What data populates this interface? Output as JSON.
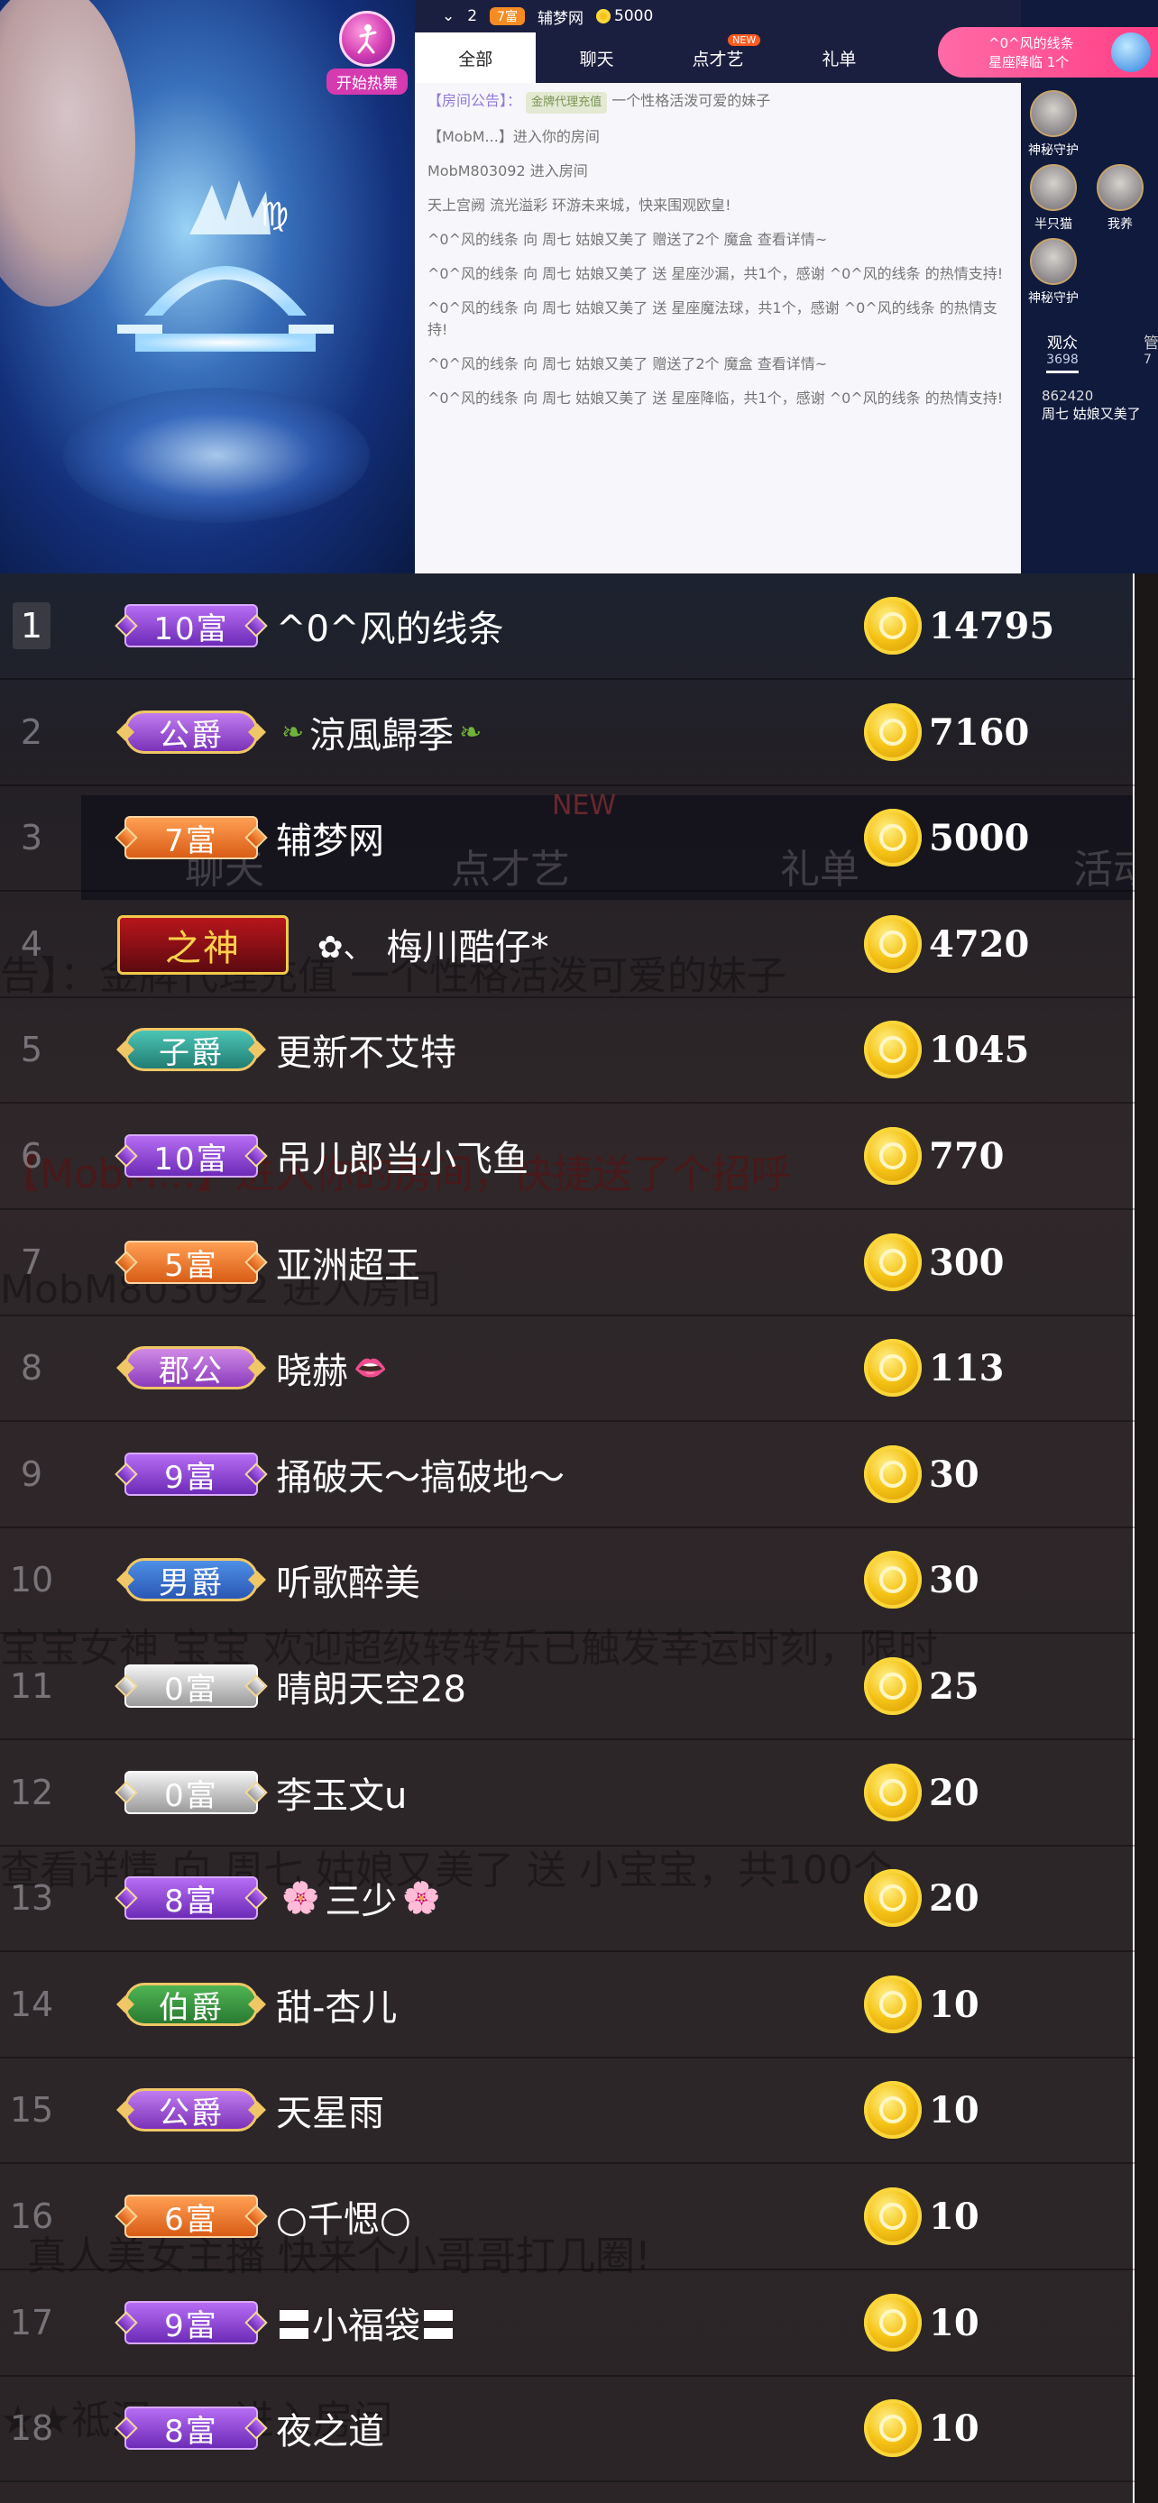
{
  "stream": {
    "start_button_label": "开始热舞",
    "star_banner": {
      "line1": "^0^风的线条",
      "line2": "星座降临 1个"
    }
  },
  "chat_panel": {
    "top_strip": {
      "rank": "2",
      "level_badge": "7富",
      "name": "辅梦网",
      "coins": "5000"
    },
    "tabs": [
      {
        "label": "全部",
        "active": true
      },
      {
        "label": "聊天",
        "active": false
      },
      {
        "label": "点才艺",
        "active": false,
        "badge": "NEW"
      },
      {
        "label": "礼单",
        "active": false
      },
      {
        "label": "活动",
        "active": false
      }
    ],
    "messages": [
      {
        "prefix": "【房间公告】：",
        "tag": "金牌代理充值",
        "text": "一个性格活泼可爱的妹子"
      },
      {
        "prefix": "",
        "tag": "",
        "text": "【MobM...】进入你的房间"
      },
      {
        "prefix": "",
        "tag": "",
        "text": "MobM803092 进入房间"
      },
      {
        "prefix": "",
        "tag": "",
        "text": "天上宫阙 流光溢彩 环游未来城，快来围观欧皇!"
      },
      {
        "prefix": "",
        "tag": "",
        "text": "^0^风的线条 向 周七 姑娘又美了 赠送了2个 魔盒 查看详情~"
      },
      {
        "prefix": "",
        "tag": "",
        "text": "^0^风的线条 向 周七 姑娘又美了 送 星座沙漏，共1个，感谢 ^0^风的线条 的热情支持!"
      },
      {
        "prefix": "",
        "tag": "",
        "text": "^0^风的线条 向 周七 姑娘又美了 送 星座魔法球，共1个，感谢 ^0^风的线条 的热情支持!"
      },
      {
        "prefix": "",
        "tag": "",
        "text": "^0^风的线条 向 周七 姑娘又美了 赠送了2个 魔盒 查看详情~"
      },
      {
        "prefix": "",
        "tag": "",
        "text": "^0^风的线条 向 周七 姑娘又美了 送 星座降临，共1个，感谢 ^0^风的线条 的热情支持!"
      }
    ]
  },
  "side_panel": {
    "guards": [
      {
        "label": "神秘守护"
      },
      {
        "label": "半只猫"
      },
      {
        "label": "我养"
      },
      {
        "label": "神秘守护"
      }
    ],
    "audience_label": "观众",
    "audience_count": "3698",
    "manager_label": "管",
    "manager_count": "7",
    "rank_score": "862420",
    "rank_name": "周七 姑娘又美了"
  },
  "ranking": {
    "background_text": [
      "聊天",
      "点才艺",
      "礼单",
      "活动",
      "NEW",
      "告】：金牌代理充值 一个性格活泼可爱的妹子",
      "【MobM...】进入你的房间，快捷送了个招呼",
      "MobM803092 进入房间",
      "宝宝女神 宝宝 欢迎超级转转乐已触发幸运时刻，限时",
      "查看详情 向 周七 姑娘又美了 送 小宝宝，共100个",
      "真人美女主播 快来个小哥哥打几圈!",
      "★★祗洞★★ 进入房间"
    ],
    "rows": [
      {
        "rank": "1",
        "badge": "10富",
        "badge_style": "b-purple",
        "name": "^0^风的线条",
        "deco_before": "",
        "deco_after": "",
        "amount": "14795"
      },
      {
        "rank": "2",
        "badge": "公爵",
        "badge_style": "b-duke",
        "name": "涼風歸季",
        "deco_before": "❧",
        "deco_after": "❧",
        "deco_style": "",
        "amount": "7160"
      },
      {
        "rank": "3",
        "badge": "7富",
        "badge_style": "b-orange",
        "name": "辅梦网",
        "deco_before": "",
        "deco_after": "",
        "amount": "5000"
      },
      {
        "rank": "4",
        "badge": "之神",
        "badge_style": "b-god",
        "name": "梅川酷仔*",
        "deco_before": "✿、",
        "deco_after": "",
        "deco_style": "star",
        "amount": "4720"
      },
      {
        "rank": "5",
        "badge": "子爵",
        "badge_style": "b-zi",
        "name": "更新不艾特",
        "deco_before": "",
        "deco_after": "",
        "amount": "1045"
      },
      {
        "rank": "6",
        "badge": "10富",
        "badge_style": "b-purple",
        "name": "吊儿郎当小飞鱼",
        "deco_before": "",
        "deco_after": "",
        "amount": "770"
      },
      {
        "rank": "7",
        "badge": "5富",
        "badge_style": "b-orange",
        "name": "亚洲超王",
        "deco_before": "",
        "deco_after": "",
        "amount": "300"
      },
      {
        "rank": "8",
        "badge": "郡公",
        "badge_style": "b-jun",
        "name": "晓赫",
        "deco_before": "",
        "deco_after": "👄",
        "deco_style": "lips",
        "amount": "113"
      },
      {
        "rank": "9",
        "badge": "9富",
        "badge_style": "b-purple",
        "name": "捅破天～搞破地～",
        "deco_before": "",
        "deco_after": "",
        "amount": "30"
      },
      {
        "rank": "10",
        "badge": "男爵",
        "badge_style": "b-nan",
        "name": "听歌醉美",
        "deco_before": "",
        "deco_after": "",
        "amount": "30"
      },
      {
        "rank": "11",
        "badge": "0富",
        "badge_style": "b-silver",
        "name": "晴朗天空28",
        "deco_before": "",
        "deco_after": "",
        "amount": "25"
      },
      {
        "rank": "12",
        "badge": "0富",
        "badge_style": "b-silver",
        "name": "李玉文u",
        "deco_before": "",
        "deco_after": "",
        "amount": "20"
      },
      {
        "rank": "13",
        "badge": "8富",
        "badge_style": "b-purple",
        "name": "三少",
        "deco_before": "🌸",
        "deco_after": "🌸",
        "deco_style": "flower",
        "amount": "20"
      },
      {
        "rank": "14",
        "badge": "伯爵",
        "badge_style": "b-bo",
        "name": "甜-杏儿",
        "deco_before": "",
        "deco_after": "",
        "amount": "10"
      },
      {
        "rank": "15",
        "badge": "公爵",
        "badge_style": "b-duke",
        "name": "天星雨",
        "deco_before": "",
        "deco_after": "",
        "amount": "10"
      },
      {
        "rank": "16",
        "badge": "6富",
        "badge_style": "b-orange",
        "name": "○千愢○",
        "deco_before": "",
        "deco_after": "",
        "amount": "10"
      },
      {
        "rank": "17",
        "badge": "9富",
        "badge_style": "b-purple",
        "name": "〓小福袋〓",
        "deco_before": "",
        "deco_after": "",
        "amount": "10"
      },
      {
        "rank": "18",
        "badge": "8富",
        "badge_style": "b-purple",
        "name": "夜之道",
        "deco_before": "",
        "deco_after": "",
        "amount": "10"
      }
    ]
  },
  "colors": {
    "background": "#2a2426",
    "coin_gold": "#f5c316",
    "text": "#ffffff",
    "chat_tab_bar": "#1b1f3f",
    "star_banner": "#ff3f85"
  }
}
